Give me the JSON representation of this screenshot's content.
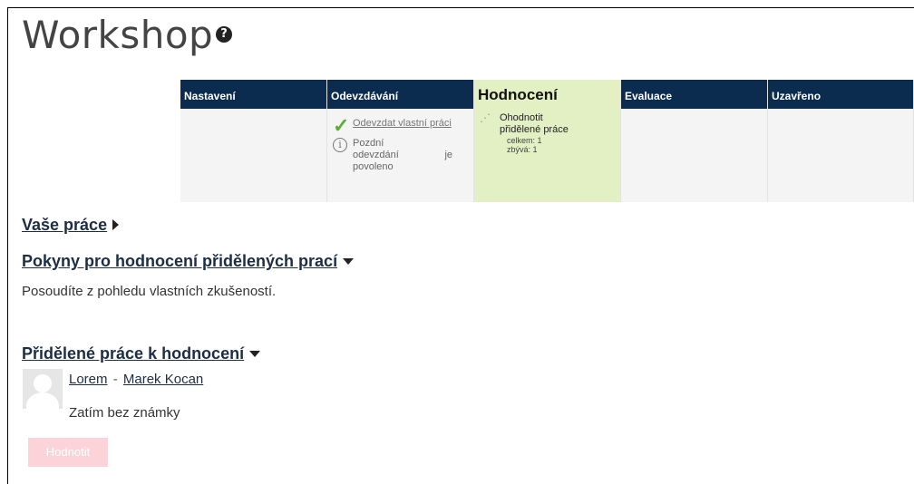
{
  "title": "Workshop",
  "help_icon": "?",
  "phases": [
    {
      "name": "Nastavení"
    },
    {
      "name": "Odevzdávání",
      "task1": "Odevzdat vlastní práci",
      "task2_line1": "Pozdní",
      "task2_line2": "odevzdání",
      "task2_je": "je",
      "task2_line3": "povoleno"
    },
    {
      "name": "Hodnocení",
      "task": "Ohodnotit přidělené práce",
      "celkem": "celkem: 1",
      "zbyva": "zbývá: 1"
    },
    {
      "name": "Evaluace"
    },
    {
      "name": "Uzavřeno"
    }
  ],
  "sections": {
    "your_work": "Vaše práce",
    "instructions": "Pokyny pro hodnocení přidělených prací",
    "instructions_text": "Posoudíte z pohledu vlastních zkušeností.",
    "assigned": "Přidělené práce k hodnocení"
  },
  "submission": {
    "title": "Lorem",
    "separator": "-",
    "author": "Marek Kocan",
    "status": "Zatím bez známky",
    "button": "Hodnotit"
  },
  "colors": {
    "phase_header": "#0b2c4e",
    "active_phase": "#e3f0c4",
    "button": "#fcd3d9",
    "check": "#5aae37"
  }
}
